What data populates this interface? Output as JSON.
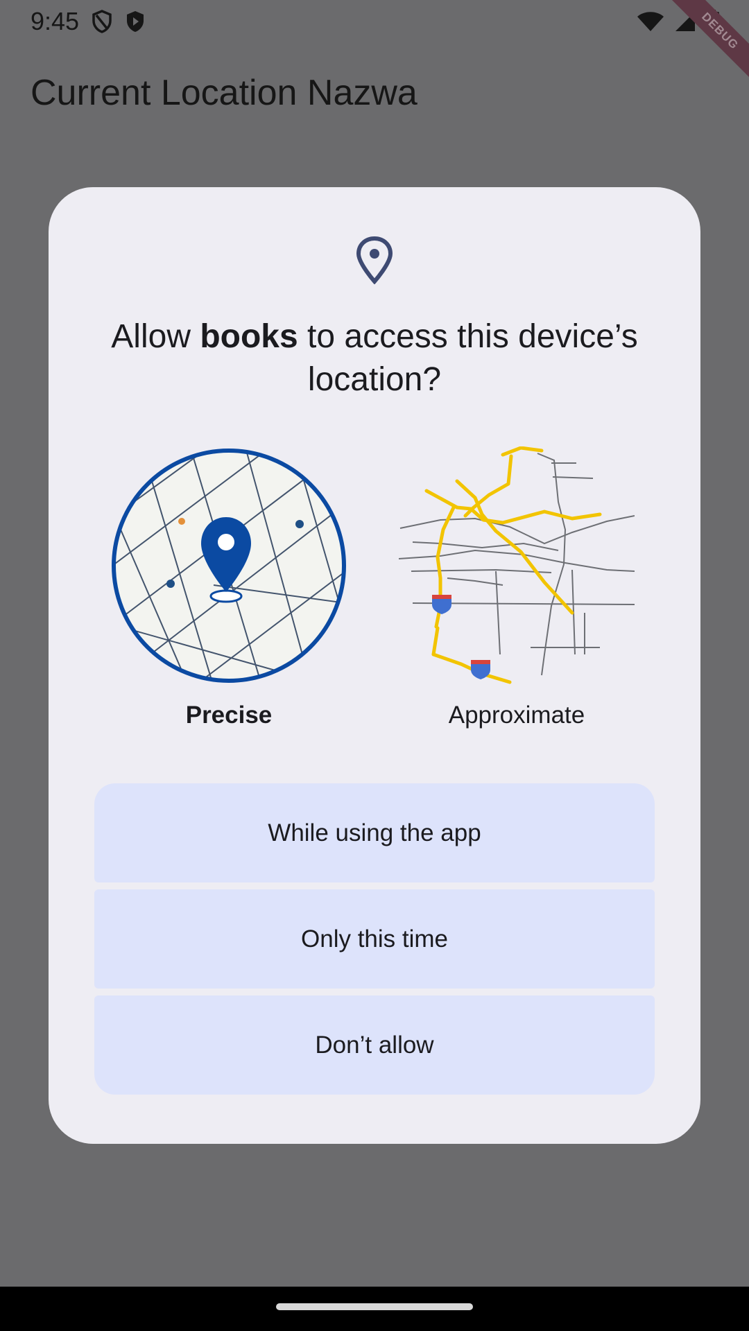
{
  "status_bar": {
    "time": "9:45",
    "icons": [
      "shield-outline-icon",
      "play-shield-icon",
      "wifi-icon",
      "cell-signal-icon",
      "battery-icon"
    ]
  },
  "debug_banner": "DEBUG",
  "app_bar": {
    "title": "Current Location Nazwa"
  },
  "dialog": {
    "icon": "location-pin-icon",
    "title_prefix": "Allow ",
    "title_app": "books",
    "title_suffix": " to access this device’s location?",
    "options": {
      "precise_label": "Precise",
      "approximate_label": "Approximate",
      "selected": "Precise"
    },
    "buttons": {
      "while_using": "While using the app",
      "only_this_time": "Only this time",
      "dont_allow": "Don’t allow"
    }
  },
  "colors": {
    "scrim": "#6b6b6d",
    "dialog_bg": "#eeedf3",
    "button_bg": "#dde3fb",
    "accent": "#0b4aa2",
    "map_roads": "#f2c400"
  }
}
